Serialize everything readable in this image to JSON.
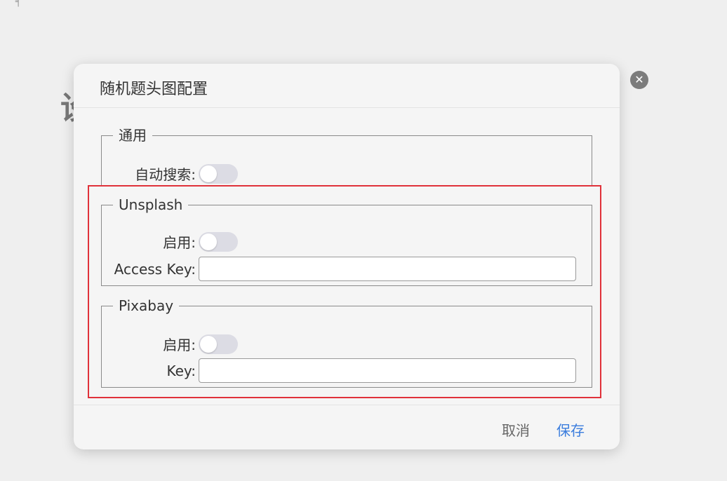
{
  "background": {
    "corner_mark": "╕",
    "partial_heading": "设"
  },
  "dialog": {
    "title": "随机题头图配置",
    "general": {
      "legend": "通用",
      "auto_search_label": "自动搜索:",
      "auto_search_enabled": false
    },
    "unsplash": {
      "legend": "Unsplash",
      "enable_label": "启用:",
      "enabled": false,
      "access_key_label": "Access Key:",
      "access_key_value": ""
    },
    "pixabay": {
      "legend": "Pixabay",
      "enable_label": "启用:",
      "enabled": false,
      "key_label": "Key:",
      "key_value": ""
    },
    "footer": {
      "cancel_label": "取消",
      "save_label": "保存"
    }
  },
  "colors": {
    "highlight_border": "#e0313a",
    "save_button": "#3b7ddd",
    "cancel_button": "#666666"
  },
  "icons": {
    "close": "close-icon"
  }
}
